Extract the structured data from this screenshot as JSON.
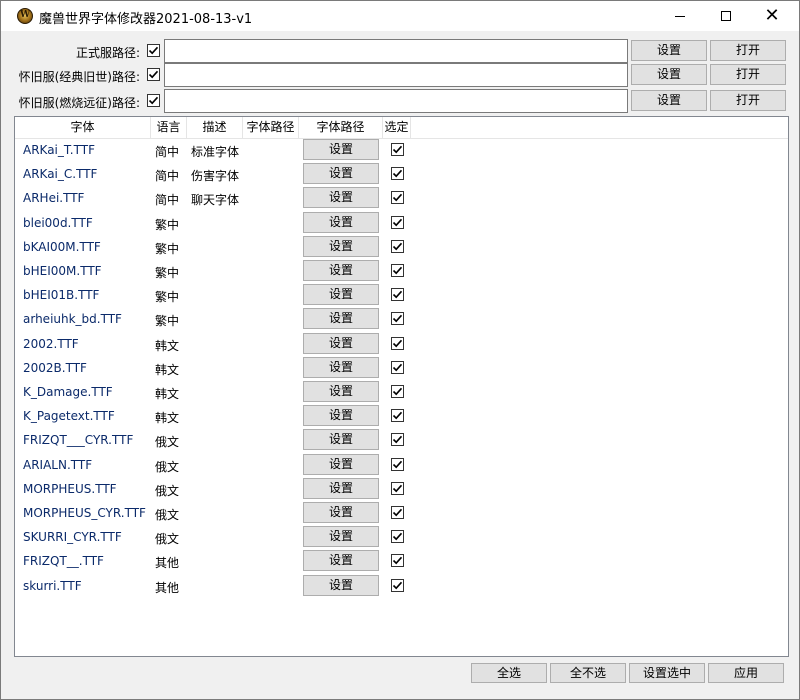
{
  "window": {
    "title": "魔兽世界字体修改器2021-08-13-v1",
    "close_glyph": "✕"
  },
  "paths": [
    {
      "label": "正式服路径:",
      "checked": true,
      "value": "",
      "set_label": "设置",
      "open_label": "打开"
    },
    {
      "label": "怀旧服(经典旧世)路径:",
      "checked": true,
      "value": "",
      "set_label": "设置",
      "open_label": "打开"
    },
    {
      "label": "怀旧服(燃烧远征)路径:",
      "checked": true,
      "value": "",
      "set_label": "设置",
      "open_label": "打开"
    }
  ],
  "table": {
    "columns": [
      "字体",
      "语言",
      "描述",
      "字体路径",
      "字体路径",
      "选定"
    ],
    "row_button_label": "设置",
    "rows": [
      {
        "font": "ARKai_T.TTF",
        "lang": "简中",
        "desc": "标准字体",
        "checked": true
      },
      {
        "font": "ARKai_C.TTF",
        "lang": "简中",
        "desc": "伤害字体",
        "checked": true
      },
      {
        "font": "ARHei.TTF",
        "lang": "简中",
        "desc": "聊天字体",
        "checked": true
      },
      {
        "font": "blei00d.TTF",
        "lang": "繁中",
        "desc": "",
        "checked": true
      },
      {
        "font": "bKAI00M.TTF",
        "lang": "繁中",
        "desc": "",
        "checked": true
      },
      {
        "font": "bHEI00M.TTF",
        "lang": "繁中",
        "desc": "",
        "checked": true
      },
      {
        "font": "bHEI01B.TTF",
        "lang": "繁中",
        "desc": "",
        "checked": true
      },
      {
        "font": "arheiuhk_bd.TTF",
        "lang": "繁中",
        "desc": "",
        "checked": true
      },
      {
        "font": "2002.TTF",
        "lang": "韩文",
        "desc": "",
        "checked": true
      },
      {
        "font": "2002B.TTF",
        "lang": "韩文",
        "desc": "",
        "checked": true
      },
      {
        "font": "K_Damage.TTF",
        "lang": "韩文",
        "desc": "",
        "checked": true
      },
      {
        "font": "K_Pagetext.TTF",
        "lang": "韩文",
        "desc": "",
        "checked": true
      },
      {
        "font": "FRIZQT___CYR.TTF",
        "lang": "俄文",
        "desc": "",
        "checked": true
      },
      {
        "font": "ARIALN.TTF",
        "lang": "俄文",
        "desc": "",
        "checked": true
      },
      {
        "font": "MORPHEUS.TTF",
        "lang": "俄文",
        "desc": "",
        "checked": true
      },
      {
        "font": "MORPHEUS_CYR.TTF",
        "lang": "俄文",
        "desc": "",
        "checked": true
      },
      {
        "font": "SKURRI_CYR.TTF",
        "lang": "俄文",
        "desc": "",
        "checked": true
      },
      {
        "font": "FRIZQT__.TTF",
        "lang": "其他",
        "desc": "",
        "checked": true
      },
      {
        "font": "skurri.TTF",
        "lang": "其他",
        "desc": "",
        "checked": true
      }
    ]
  },
  "footer": {
    "select_all": "全选",
    "select_none": "全不选",
    "set_selected": "设置选中",
    "apply": "应用"
  }
}
